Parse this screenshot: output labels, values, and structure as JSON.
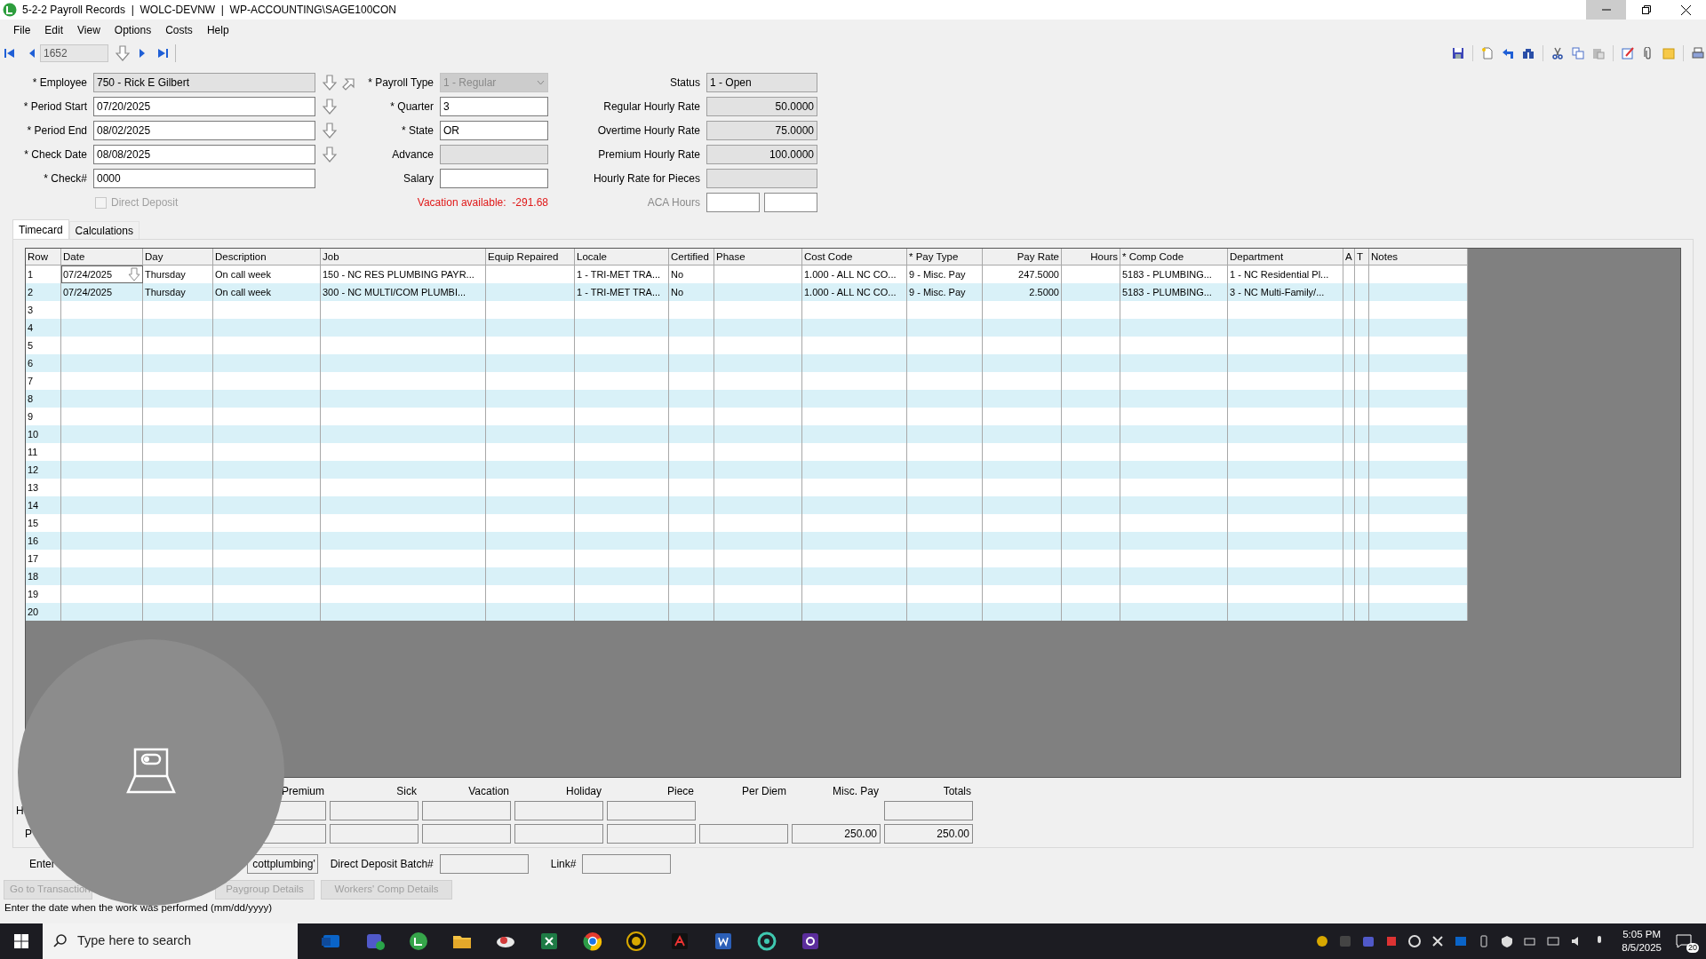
{
  "window": {
    "title": "5-2-2 Payroll Records  |  WOLC-DEVNW  |  WP-ACCOUNTING\\SAGE100CON"
  },
  "menu": [
    "File",
    "Edit",
    "View",
    "Options",
    "Costs",
    "Help"
  ],
  "record_nav": {
    "value": "1652"
  },
  "form": {
    "left": [
      {
        "kind": "field",
        "label": "* Employee",
        "value": "750 - Rick E Gilbert",
        "readonly": true,
        "lookup": true,
        "jump": true
      },
      {
        "kind": "field",
        "label": "* Period Start",
        "value": "07/20/2025",
        "readonly": false,
        "lookup": true,
        "jump": false
      },
      {
        "kind": "field",
        "label": "* Period End",
        "value": "08/02/2025",
        "readonly": false,
        "lookup": true,
        "jump": false
      },
      {
        "kind": "field",
        "label": "* Check Date",
        "value": "08/08/2025",
        "readonly": false,
        "lookup": true,
        "jump": false
      },
      {
        "kind": "field",
        "label": "* Check#",
        "value": "0000",
        "readonly": false,
        "lookup": false,
        "jump": false
      },
      {
        "kind": "checkbox",
        "label": "Direct Deposit",
        "checked": false,
        "disabled": true
      }
    ],
    "middle": [
      {
        "kind": "dropdown",
        "label": "* Payroll Type",
        "value": "1 - Regular",
        "disabled": true
      },
      {
        "kind": "field",
        "label": "* Quarter",
        "value": "3",
        "readonly": false
      },
      {
        "kind": "field",
        "label": "* State",
        "value": "OR",
        "readonly": false
      },
      {
        "kind": "field",
        "label": "Advance",
        "readonly": true
      },
      {
        "kind": "field",
        "label": "Salary",
        "readonly": false
      },
      {
        "kind": "warning",
        "text": "Vacation available:  -291.68"
      }
    ],
    "right": [
      {
        "kind": "field",
        "label": "Status",
        "value": "1 - Open",
        "readonly": true,
        "numeric": false
      },
      {
        "kind": "field",
        "label": "Regular Hourly Rate",
        "value": "50.0000",
        "readonly": true,
        "numeric": true
      },
      {
        "kind": "field",
        "label": "Overtime Hourly Rate",
        "value": "75.0000",
        "readonly": true,
        "numeric": true
      },
      {
        "kind": "field",
        "label": "Premium Hourly Rate",
        "value": "100.0000",
        "readonly": true,
        "numeric": true
      },
      {
        "kind": "field",
        "label": "Hourly Rate for Pieces",
        "readonly": true,
        "numeric": false
      },
      {
        "kind": "pair",
        "label": "ACA Hours",
        "disabled": true
      }
    ]
  },
  "tabs": [
    {
      "label": "Timecard",
      "selected": true
    },
    {
      "label": "Calculations",
      "selected": false
    }
  ],
  "table": {
    "columns": [
      {
        "label": "Row",
        "numeric": false
      },
      {
        "label": "Date",
        "numeric": false
      },
      {
        "label": "Day",
        "numeric": false
      },
      {
        "label": "Description",
        "numeric": false
      },
      {
        "label": "Job",
        "numeric": false
      },
      {
        "label": "Equip Repaired",
        "numeric": false
      },
      {
        "label": "Locale",
        "numeric": false
      },
      {
        "label": "Certified",
        "numeric": false
      },
      {
        "label": "Phase",
        "numeric": false
      },
      {
        "label": "Cost Code",
        "numeric": false
      },
      {
        "label": "* Pay Type",
        "numeric": false
      },
      {
        "label": "Pay Rate",
        "numeric": true
      },
      {
        "label": "Hours",
        "numeric": true
      },
      {
        "label": "* Comp Code",
        "numeric": false
      },
      {
        "label": "Department",
        "numeric": false
      },
      {
        "label": "A",
        "numeric": false
      },
      {
        "label": "T",
        "numeric": false
      },
      {
        "label": "Notes",
        "numeric": false
      }
    ],
    "rows": [
      {
        "active": true,
        "cells": [
          "1",
          "07/24/2025",
          "Thursday",
          "On call week",
          "150 - NC RES PLUMBING PAYR...",
          null,
          "1 - TRI-MET TRA...",
          "No",
          null,
          "1.000 - ALL NC CO...",
          "9 - Misc. Pay",
          "247.5000",
          null,
          "5183 - PLUMBING...",
          "1 - NC Residential Pl...",
          null,
          null,
          null
        ]
      },
      {
        "active": false,
        "cells": [
          "2",
          "07/24/2025",
          "Thursday",
          "On call week",
          "300 - NC MULTI/COM PLUMBI...",
          null,
          "1 - TRI-MET TRA...",
          "No",
          null,
          "1.000 - ALL NC CO...",
          "9 - Misc. Pay",
          "2.5000",
          null,
          "5183 - PLUMBING...",
          "3 - NC Multi-Family/...",
          null,
          null,
          null
        ]
      },
      {
        "active": false,
        "cells": [
          "3"
        ]
      },
      {
        "active": false,
        "cells": [
          "4"
        ]
      },
      {
        "active": false,
        "cells": [
          "5"
        ]
      },
      {
        "active": false,
        "cells": [
          "6"
        ]
      },
      {
        "active": false,
        "cells": [
          "7"
        ]
      },
      {
        "active": false,
        "cells": [
          "8"
        ]
      },
      {
        "active": false,
        "cells": [
          "9"
        ]
      },
      {
        "active": false,
        "cells": [
          "10"
        ]
      },
      {
        "active": false,
        "cells": [
          "11"
        ]
      },
      {
        "active": false,
        "cells": [
          "12"
        ]
      },
      {
        "active": false,
        "cells": [
          "13"
        ]
      },
      {
        "active": false,
        "cells": [
          "14"
        ]
      },
      {
        "active": false,
        "cells": [
          "15"
        ]
      },
      {
        "active": false,
        "cells": [
          "16"
        ]
      },
      {
        "active": false,
        "cells": [
          "17"
        ]
      },
      {
        "active": false,
        "cells": [
          "18"
        ]
      },
      {
        "active": false,
        "cells": [
          "19"
        ]
      },
      {
        "active": false,
        "cells": [
          "20"
        ]
      }
    ]
  },
  "totals": {
    "columns": [
      "Premium",
      "Sick",
      "Vacation",
      "Holiday",
      "Piece",
      "Per Diem",
      "Misc. Pay",
      "Totals"
    ],
    "rows": [
      {
        "label": "H",
        "cells": [
          {
            "kind": "field"
          },
          {
            "kind": "field"
          },
          {
            "kind": "field"
          },
          {
            "kind": "field"
          },
          {
            "kind": "field"
          },
          {
            "kind": "blank"
          },
          {
            "kind": "blank"
          },
          {
            "kind": "field"
          }
        ]
      },
      {
        "label": "P",
        "cells": [
          {
            "kind": "field"
          },
          {
            "kind": "field"
          },
          {
            "kind": "field"
          },
          {
            "kind": "field"
          },
          {
            "kind": "field"
          },
          {
            "kind": "field"
          },
          {
            "kind": "field",
            "value": "250.00"
          },
          {
            "kind": "field",
            "value": "250.00"
          }
        ]
      }
    ]
  },
  "entry_row": {
    "entered_label": "Enter",
    "entered_value": "cottplumbing'",
    "batch_label": "Direct Deposit Batch#",
    "link_label": "Link#"
  },
  "buttons": [
    {
      "label": "Go to Transaction",
      "disabled": true
    },
    {
      "label": "Paygroup Details",
      "disabled": true
    },
    {
      "label": "Workers' Comp Details",
      "disabled": true
    }
  ],
  "status_bar": "Enter the date when the work was performed (mm/dd/yyyy)",
  "taskbar": {
    "search_placeholder": "Type here to search",
    "time": "5:05 PM",
    "date": "8/5/2025",
    "notifications": "20"
  }
}
